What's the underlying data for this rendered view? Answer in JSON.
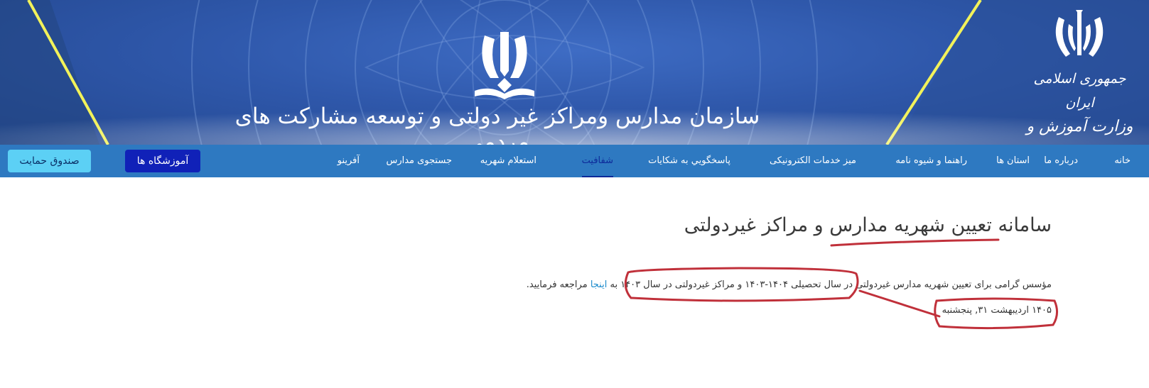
{
  "header": {
    "org_title": "سازمان مدارس ومراکز غیر دولتی و توسعه مشارکت های مردمی",
    "ministry_line1": "جمهوری اسلامی ایران",
    "ministry_line2": "وزارت آموزش و پرورش"
  },
  "nav": {
    "items": [
      {
        "label": "خانه"
      },
      {
        "label": "درباره ما"
      },
      {
        "label": "استان ها"
      },
      {
        "label": "راهنما و شیوه نامه"
      },
      {
        "label": "میز خدمات الکترونیکی"
      },
      {
        "label": "پاسخگويي به شکايات"
      },
      {
        "label": "شفافیت"
      },
      {
        "label": "استعلام شهریه"
      },
      {
        "label": "جستجوی مدارس"
      },
      {
        "label": "آفرینو"
      }
    ],
    "active": "شفافیت",
    "schools_button": "آموزشگاه ها",
    "support_button": "صندوق حمایت"
  },
  "content": {
    "title": "سامانه تعیین شهریه مدارس و مراکز غیردولتی",
    "para_before": "مؤسس گرامی برای تعیین شهریه مدارس غیردولتی در سال تحصیلی ۱۴۰۴-۱۴۰۳ و مراکز غیردولتی در سال ۱۴۰۳ به ",
    "link_text": "اینجا",
    "para_after": " مراجعه فرمایید.",
    "date": "۱۴۰۵ اردیبهشت ۳۱, پنجشنبه"
  },
  "colors": {
    "banner": "#2f58ab",
    "nav": "#2e79c1",
    "active_nav": "#0d2a9a",
    "annotation": "#c0303a"
  }
}
